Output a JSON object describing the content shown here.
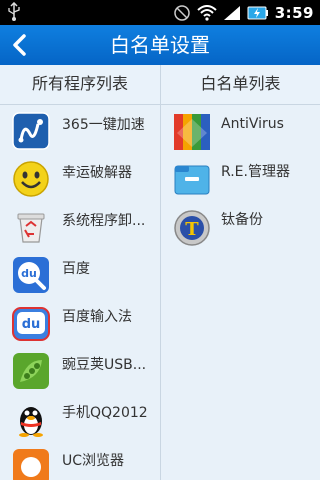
{
  "status_bar": {
    "time": "3:59"
  },
  "title_bar": {
    "title": "白名单设置"
  },
  "columns": {
    "all_apps_header": "所有程序列表",
    "whitelist_header": "白名单列表"
  },
  "all_apps": [
    {
      "label": "365一键加速",
      "icon": "speedup-app-icon"
    },
    {
      "label": "幸运破解器",
      "icon": "smiley-app-icon"
    },
    {
      "label": "系统程序卸...",
      "icon": "recycle-bin-app-icon"
    },
    {
      "label": "百度",
      "icon": "baidu-search-app-icon"
    },
    {
      "label": "百度输入法",
      "icon": "baidu-input-app-icon"
    },
    {
      "label": "豌豆荚USB...",
      "icon": "pea-pod-app-icon"
    },
    {
      "label": "手机QQ2012",
      "icon": "qq-penguin-app-icon"
    },
    {
      "label": "UC浏览器",
      "icon": "uc-browser-app-icon"
    }
  ],
  "whitelist": [
    {
      "label": "AntiVirus",
      "icon": "avg-antivirus-app-icon"
    },
    {
      "label": "R.E.管理器",
      "icon": "re-manager-app-icon"
    },
    {
      "label": "钛备份",
      "icon": "titanium-backup-app-icon"
    }
  ]
}
